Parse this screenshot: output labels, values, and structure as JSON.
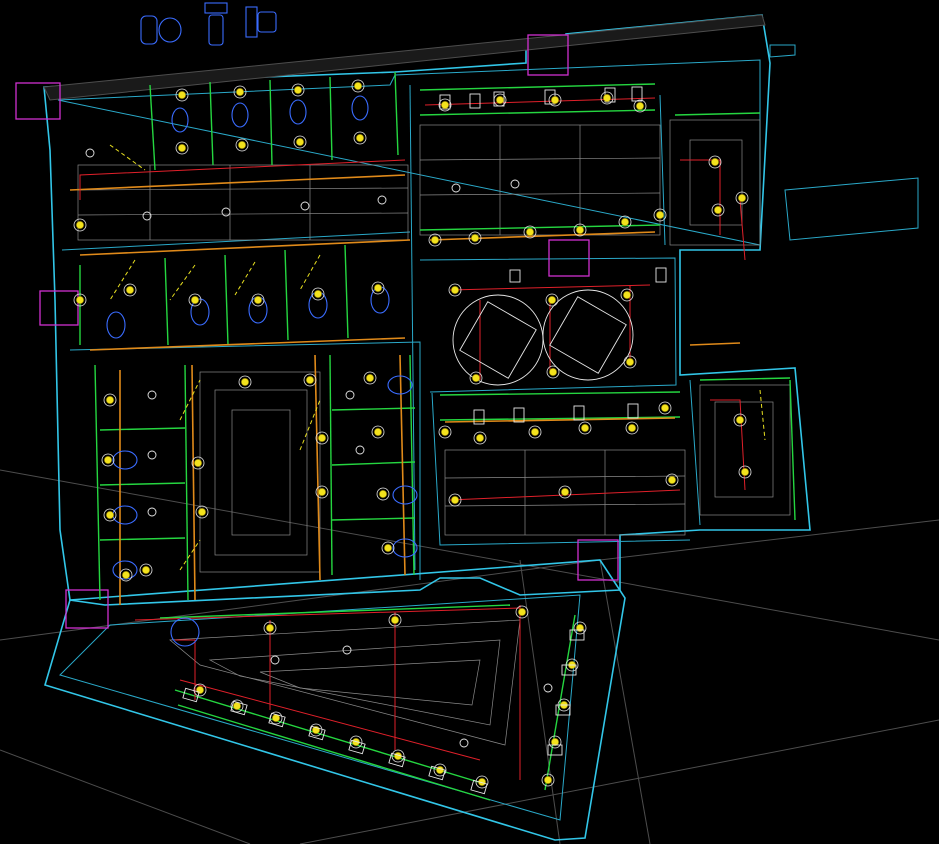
{
  "colors": {
    "background": "#000000",
    "walls": "#32c6e8",
    "partitions": "#25d640",
    "ceiling_grid": "#8a8a8a",
    "circuit_lines": "#e0202a",
    "pipe_runs": "#e08a1a",
    "fixtures": "#f3e21d",
    "columns": "#d030d0",
    "sanitary": "#3a6cff"
  },
  "icons": [
    "toilet-block-icon",
    "light-fixture-icon",
    "column-hatch-icon"
  ],
  "labels": {}
}
